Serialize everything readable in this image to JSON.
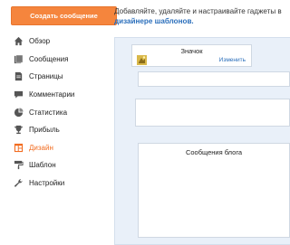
{
  "create_button": "Создать сообщение",
  "nav": [
    {
      "label": "Обзор",
      "icon": "home-icon",
      "active": false
    },
    {
      "label": "Сообщения",
      "icon": "posts-icon",
      "active": false
    },
    {
      "label": "Страницы",
      "icon": "pages-icon",
      "active": false
    },
    {
      "label": "Комментарии",
      "icon": "comment-icon",
      "active": false
    },
    {
      "label": "Статистика",
      "icon": "pie-chart-icon",
      "active": false
    },
    {
      "label": "Прибыль",
      "icon": "trophy-icon",
      "active": false
    },
    {
      "label": "Дизайн",
      "icon": "layout-icon",
      "active": true
    },
    {
      "label": "Шаблон",
      "icon": "paint-roller-icon",
      "active": false
    },
    {
      "label": "Настройки",
      "icon": "wrench-icon",
      "active": false
    }
  ],
  "intro": {
    "line1": "Добавляйте, удаляйте и настраивайте гаджеты в",
    "link": "дизайнере шаблонов."
  },
  "gadget": {
    "title": "Значок",
    "edit": "Изменить"
  },
  "posts_title": "Сообщения блога",
  "colors": {
    "accent": "#f5853d",
    "active_nav": "#f26d21",
    "link": "#2a6ebb",
    "canvas": "#e9f0f9"
  }
}
